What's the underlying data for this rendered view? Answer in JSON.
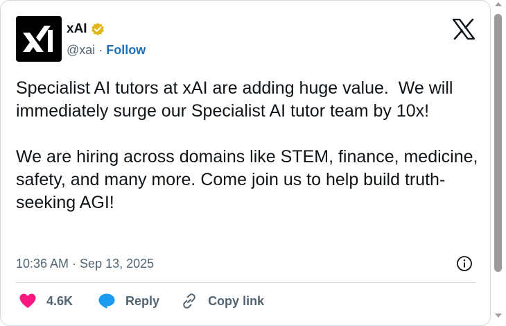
{
  "author": {
    "name": "xAI",
    "handle": "@xai",
    "separator": "·",
    "follow_label": "Follow",
    "verified": true,
    "verified_color": "#e2b719",
    "avatar_icon": "xai-logo-icon"
  },
  "brand_icon": "x-logo-icon",
  "tweet": {
    "text": "Specialist AI tutors at xAI are adding huge value.  We will immediately surge our Specialist AI tutor team by 10x!\n\nWe are hiring across domains like STEM, finance, medicine, safety, and many more. Come join us to help build truth-seeking AGI!",
    "timestamp": "10:36 AM · Sep 13, 2025"
  },
  "actions": {
    "like_count": "4.6K",
    "reply_label": "Reply",
    "copy_link_label": "Copy link"
  },
  "colors": {
    "like": "#f91880",
    "reply": "#1d9bf0",
    "follow": "#1d72b8",
    "muted": "#536471"
  }
}
